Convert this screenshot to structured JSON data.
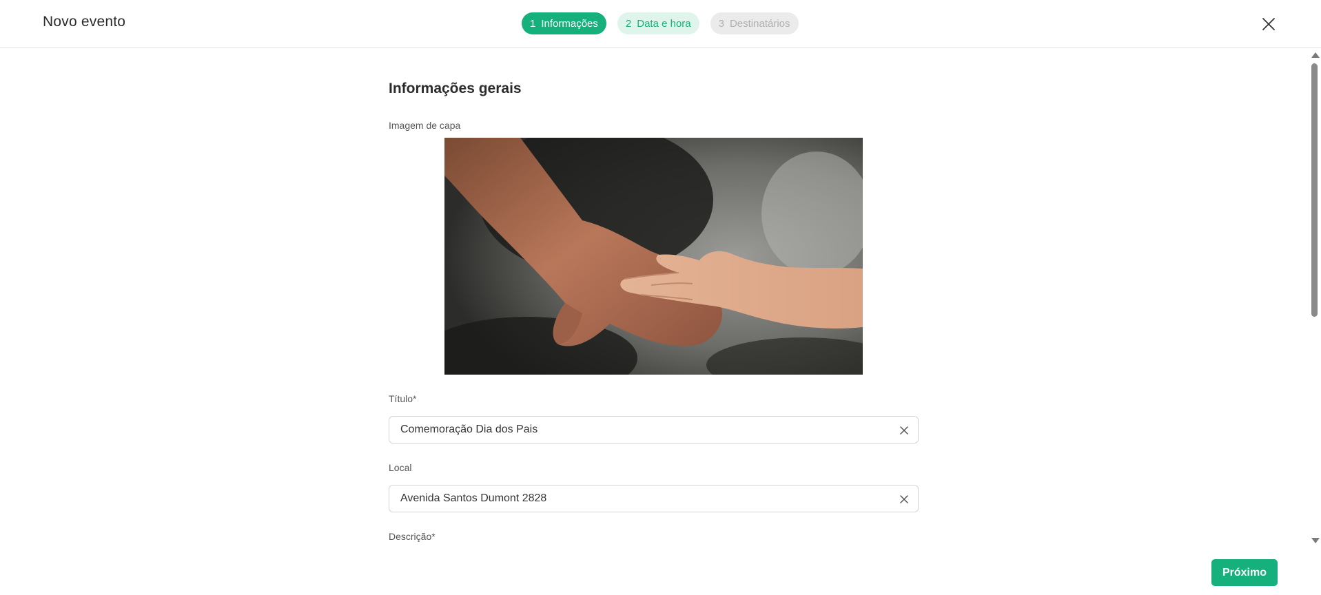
{
  "header": {
    "title": "Novo evento"
  },
  "stepper": [
    {
      "number": "1",
      "label": "Informações",
      "state": "active"
    },
    {
      "number": "2",
      "label": "Data e hora",
      "state": "next"
    },
    {
      "number": "3",
      "label": "Destinatários",
      "state": "disabled"
    }
  ],
  "form": {
    "section_title": "Informações gerais",
    "cover_image_label": "Imagem de capa",
    "title_label": "Título*",
    "title_value": "Comemoração Dia dos Pais",
    "location_label": "Local",
    "location_value": "Avenida Santos Dumont 2828",
    "description_label": "Descrição*"
  },
  "footer": {
    "next_label": "Próximo"
  },
  "colors": {
    "accent": "#16b07c",
    "accent_light": "#dff5ec",
    "disabled_bg": "#ebebeb",
    "disabled_text": "#b0b0b0"
  },
  "icons": {
    "close": "close-icon",
    "clear": "clear-icon"
  }
}
